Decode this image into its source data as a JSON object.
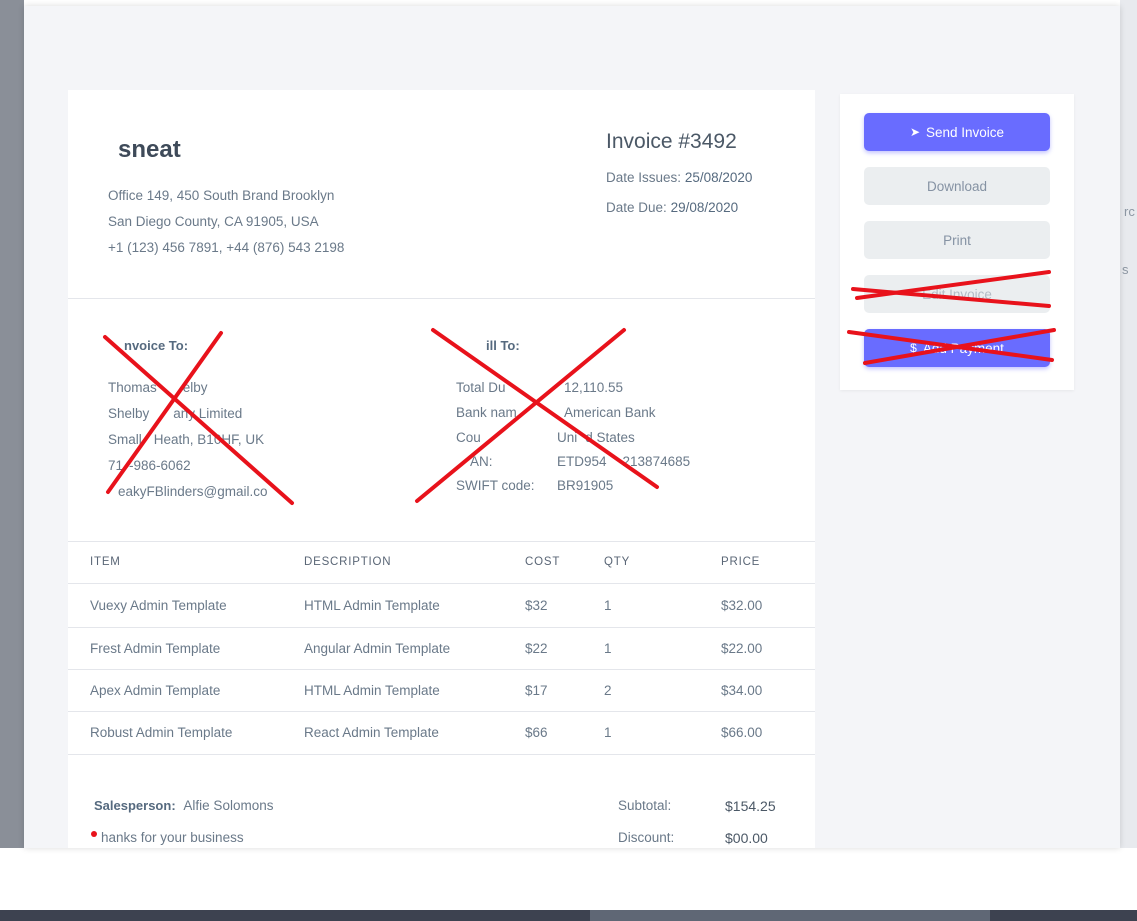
{
  "brand": "sneat",
  "company_address": [
    "Office 149, 450 South Brand Brooklyn",
    "San Diego County, CA 91905, USA",
    "+1 (123) 456 7891, +44 (876) 543 2198"
  ],
  "invoice": {
    "number": "Invoice #3492",
    "date_issued_label": "Date Issues:",
    "date_issued": "25/08/2020",
    "date_due_label": "Date Due:",
    "date_due": "29/08/2020"
  },
  "invoice_to": {
    "heading": "nvoice To:",
    "lines": [
      "Thomas",
      "elby",
      "Shelby",
      "any Limited",
      "Small",
      "Heath, B1",
      "0HF, UK",
      "71",
      "-986-6062",
      "eakyFBlinders@gmail.co"
    ]
  },
  "bill_to": {
    "heading": "ill To:",
    "rows": [
      {
        "label": "Total Du",
        "value": "12,110.55"
      },
      {
        "label": "Bank nam",
        "value": "American Bank"
      },
      {
        "label": "Cou",
        "value": "Uni",
        "value2": "d States"
      },
      {
        "label": "AN:",
        "value": "ETD954",
        "value2": "213874685"
      },
      {
        "label": "SWIFT code:",
        "value": "BR91905"
      }
    ]
  },
  "table": {
    "headers": [
      "ITEM",
      "DESCRIPTION",
      "COST",
      "QTY",
      "PRICE"
    ],
    "rows": [
      {
        "item": "Vuexy Admin Template",
        "description": "HTML Admin Template",
        "cost": "$32",
        "qty": "1",
        "price": "$32.00"
      },
      {
        "item": "Frest Admin Template",
        "description": "Angular Admin Template",
        "cost": "$22",
        "qty": "1",
        "price": "$22.00"
      },
      {
        "item": "Apex Admin Template",
        "description": "HTML Admin Template",
        "cost": "$17",
        "qty": "2",
        "price": "$34.00"
      },
      {
        "item": "Robust Admin Template",
        "description": "React Admin Template",
        "cost": "$66",
        "qty": "1",
        "price": "$66.00"
      }
    ]
  },
  "footer": {
    "salesperson_label": "Salesperson:",
    "salesperson": "Alfie Solomons",
    "thanks": "hanks for your business",
    "subtotal_label": "Subtotal:",
    "subtotal": "$154.25",
    "discount_label": "Discount:",
    "discount": "$00.00"
  },
  "actions": {
    "send_invoice": "Send Invoice",
    "download": "Download",
    "print": "Print",
    "edit_invoice": "Edit Invoice",
    "add_payment": "Add Payment"
  },
  "backdrop_fragments": [
    "rc",
    "s"
  ],
  "colors": {
    "primary": "#696cff",
    "secondary_button": "#ebeef0",
    "annotation_red": "#e8121b",
    "text": "#566a7f"
  },
  "icons": {
    "send": "paper-plane-icon",
    "add_payment": "dollar-icon"
  }
}
